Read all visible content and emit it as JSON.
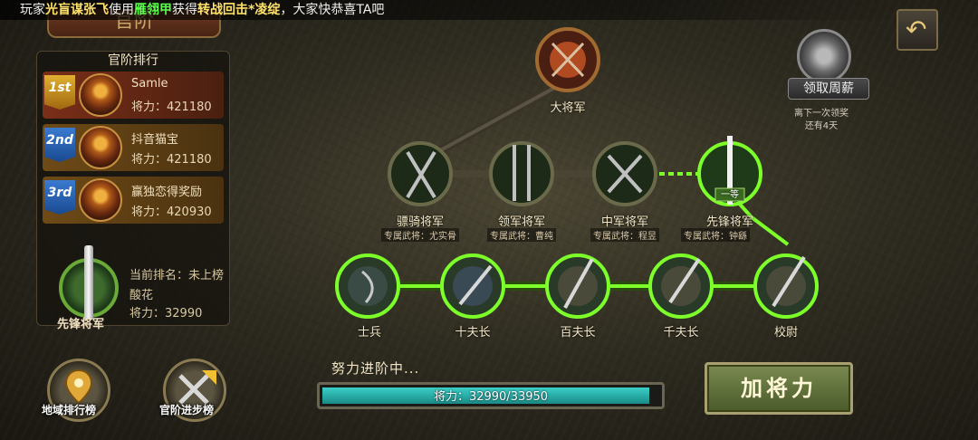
{
  "ticker": {
    "prefix": "玩家",
    "player": "光盲谋张飞",
    "mid1": "使用",
    "item1": "雁翎甲",
    "mid2": "获得",
    "item2": "转战回击*凌绽",
    "suffix": "，大家快恭喜TA吧"
  },
  "title_banner": "官阶",
  "ranking": {
    "title": "官阶排行",
    "entries": [
      {
        "rank": "1st",
        "name": "Samle",
        "power": "将力：421180"
      },
      {
        "rank": "2nd",
        "name": "抖音猫宝",
        "power": "将力：421180"
      },
      {
        "rank": "3rd",
        "name": "赢独恋得奖励",
        "power": "将力：420930"
      }
    ],
    "me": {
      "rank_text": "当前排名：未上榜",
      "name": "酸花",
      "power": "将力：32990",
      "title": "先锋将军",
      "emblem_char": "一等"
    }
  },
  "buttons": {
    "region_rank": "地域排行榜",
    "rank_progress": "官阶进步榜",
    "add_power": "加将力",
    "weekly_salary": "领取周薪"
  },
  "salary_note": [
    "离下一次领奖",
    "还有4天"
  ],
  "tree": {
    "top": {
      "label": "大将军"
    },
    "row2": [
      {
        "label": "骠骑将军",
        "sub": "专属武将：尤实骨"
      },
      {
        "label": "领军将军",
        "sub": "专属武将：曹纯"
      },
      {
        "label": "中军将军",
        "sub": "专属武将：程昱"
      },
      {
        "label": "先锋将军",
        "sub": "专属武将：钟繇"
      }
    ],
    "row3": [
      {
        "label": "士兵"
      },
      {
        "label": "十夫长"
      },
      {
        "label": "百夫长"
      },
      {
        "label": "千夫长"
      },
      {
        "label": "校尉"
      }
    ],
    "current_badge": "一等"
  },
  "progress": {
    "title": "努力进阶中...",
    "text": "将力：32990/33950",
    "fraction": 0.9717
  },
  "colors": {
    "active_line": "#7dff2a",
    "ticker_player": "#ffe36a",
    "ticker_item1": "#5cff4c",
    "progress_fill": "#2fb8b2"
  }
}
